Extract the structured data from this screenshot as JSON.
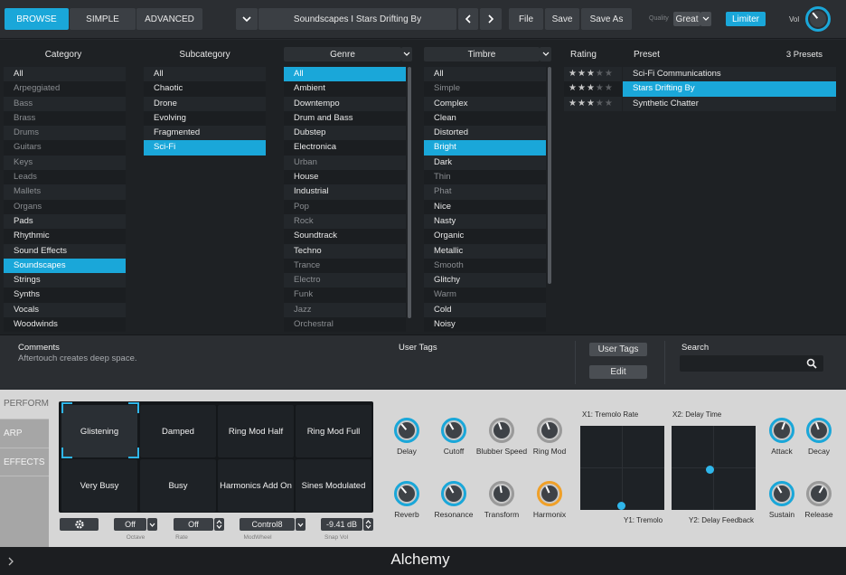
{
  "topbar": {
    "browse": "BROWSE",
    "simple": "SIMPLE",
    "advanced": "ADVANCED",
    "preset_title": "Soundscapes I Stars Drifting By",
    "file": "File",
    "save": "Save",
    "save_as": "Save As",
    "quality_label": "Quality",
    "quality_value": "Great",
    "limiter": "Limiter",
    "vol_label": "Vol"
  },
  "browser": {
    "category": {
      "header": "Category",
      "items": [
        "All",
        "Arpeggiated",
        "Bass",
        "Brass",
        "Drums",
        "Guitars",
        "Keys",
        "Leads",
        "Mallets",
        "Organs",
        "Pads",
        "Rhythmic",
        "Sound Effects",
        "Soundscapes",
        "Strings",
        "Synths",
        "Vocals",
        "Woodwinds"
      ]
    },
    "subcategory": {
      "header": "Subcategory",
      "items": [
        "All",
        "Chaotic",
        "Drone",
        "Evolving",
        "Fragmented",
        "Sci-Fi"
      ]
    },
    "genre": {
      "header": "Genre",
      "items": [
        "All",
        "Ambient",
        "Downtempo",
        "Drum and Bass",
        "Dubstep",
        "Electronica",
        "Urban",
        "House",
        "Industrial",
        "Pop",
        "Rock",
        "Soundtrack",
        "Techno",
        "Trance",
        "Electro",
        "Funk",
        "Jazz",
        "Orchestral"
      ]
    },
    "timbre": {
      "header": "Timbre",
      "items": [
        "All",
        "Simple",
        "Complex",
        "Clean",
        "Distorted",
        "Bright",
        "Dark",
        "Thin",
        "Phat",
        "Nice",
        "Nasty",
        "Organic",
        "Metallic",
        "Smooth",
        "Glitchy",
        "Warm",
        "Cold",
        "Noisy"
      ]
    },
    "rating_header": "Rating",
    "preset_header": "Preset",
    "preset_count": "3 Presets",
    "presets": [
      {
        "name": "Sci-Fi Communications",
        "rating": 3
      },
      {
        "name": "Stars Drifting By",
        "rating": 3
      },
      {
        "name": "Synthetic Chatter",
        "rating": 3
      }
    ]
  },
  "comments": {
    "label": "Comments",
    "text": "Aftertouch creates deep space.",
    "user_tags_label": "User Tags",
    "user_tags_button": "User Tags",
    "edit_button": "Edit",
    "search_label": "Search",
    "search_value": ""
  },
  "perform": {
    "tabs": [
      "PERFORM",
      "ARP",
      "EFFECTS"
    ],
    "pads": [
      "Glistening",
      "Damped",
      "Ring Mod Half",
      "Ring Mod Full",
      "Very Busy",
      "Busy",
      "Harmonics Add On",
      "Sines Modulated"
    ],
    "controls": {
      "octave_value": "Off",
      "octave_label": "Octave",
      "rate_value": "Off",
      "rate_label": "Rate",
      "modwheel_value": "Control8",
      "modwheel_label": "ModWheel",
      "snapvol_value": "-9.41 dB",
      "snapvol_label": "Snap Vol"
    },
    "knobs_row1": [
      "Delay",
      "Cutoff",
      "Blubber Speed",
      "Ring Mod"
    ],
    "knobs_row2": [
      "Reverb",
      "Resonance",
      "Transform",
      "Harmonix"
    ],
    "xy1": {
      "x_label": "X1: Tremolo Rate",
      "y_label": "Y1: Tremolo"
    },
    "xy2": {
      "x_label": "X2: Delay Time",
      "y_label": "Y2: Delay Feedback"
    },
    "env_knobs": [
      "Attack",
      "Decay",
      "Sustain",
      "Release"
    ]
  },
  "bottom": {
    "title": "Alchemy"
  },
  "colors": {
    "accent": "#1aa7d9",
    "orange": "#f0a028"
  }
}
